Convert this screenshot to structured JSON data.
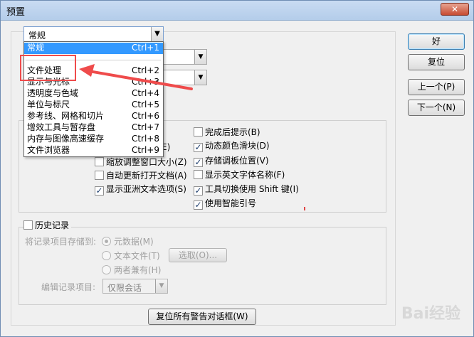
{
  "window": {
    "title": "预置"
  },
  "general_select": {
    "value": "常规"
  },
  "dropdown_items": [
    {
      "label": "常规",
      "shortcut": "Ctrl+1"
    },
    {
      "label": "文件处理",
      "shortcut": "Ctrl+2"
    },
    {
      "label": "显示与光标",
      "shortcut": "Ctrl+3"
    },
    {
      "label": "透明度与色域",
      "shortcut": "Ctrl+4"
    },
    {
      "label": "单位与标尺",
      "shortcut": "Ctrl+5"
    },
    {
      "label": "参考线、网格和切片",
      "shortcut": "Ctrl+6"
    },
    {
      "label": "增效工具与暂存盘",
      "shortcut": "Ctrl+7"
    },
    {
      "label": "内存与图像高速缓存",
      "shortcut": "Ctrl+8"
    },
    {
      "label": "文件浏览器",
      "shortcut": "Ctrl+9"
    }
  ],
  "buttons": {
    "ok": "好",
    "reset": "复位",
    "prev": "上一个(P)",
    "next": "下一个(N)",
    "reset_warnings": "复位所有警告对话框(W)",
    "choose": "选取(O)..."
  },
  "options": {
    "left": [
      {
        "label": "缩放调整窗口大小(Z)",
        "checked": false
      },
      {
        "label": "自动更新打开文档(A)",
        "checked": false
      },
      {
        "label": "显示亚洲文本选项(S)",
        "checked": true
      }
    ],
    "right": [
      {
        "label": "完成后提示(B)",
        "checked": false
      },
      {
        "label": "动态颜色滑块(D)",
        "checked": true
      },
      {
        "label": "存储调板位置(V)",
        "checked": true
      },
      {
        "label": "显示英文字体名称(F)",
        "checked": false
      },
      {
        "label": "工具切换使用 Shift 键(I)",
        "checked": true
      },
      {
        "label": "使用智能引号",
        "checked": true
      }
    ]
  },
  "partial_label": "E)",
  "history": {
    "title": "历史记录",
    "save_to_label": "将记录项目存储到:",
    "radios": [
      "元数据(M)",
      "文本文件(T)",
      "两者兼有(H)"
    ],
    "edit_label": "编辑记录项目:",
    "edit_value": "仅限会话"
  },
  "watermark": "Bai经验"
}
